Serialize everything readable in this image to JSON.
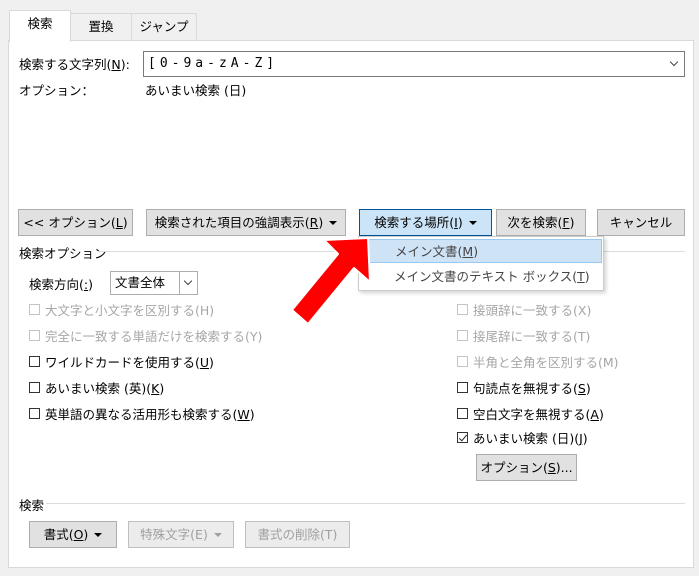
{
  "tabs": [
    "検索",
    "置換",
    "ジャンプ"
  ],
  "find": {
    "label": "検索する文字列",
    "label_key": "N",
    "label_suffix": "):",
    "value": "[0-9a-zA-Z]",
    "options_label": "オプション：",
    "options_value": "あいまい検索 (日)"
  },
  "buttons": {
    "less": "<< オプション(",
    "less_key": "L",
    "highlight": "検索された項目の強調表示(",
    "highlight_key": "R",
    "find_in": "検索する場所(",
    "find_in_key": "I",
    "find_next": "次を検索(",
    "find_next_key": "F",
    "cancel": "キャンセル"
  },
  "menu": {
    "items": [
      {
        "label": "メイン文書(",
        "key": "M"
      },
      {
        "label": "メイン文書のテキスト ボックス(",
        "key": "T"
      }
    ]
  },
  "search_options": {
    "title": "検索オプション",
    "direction_label": "検索方向(",
    "direction_key": ":",
    "direction_value": "文書全体",
    "left": [
      {
        "label": "大文字と小文字を区別する(H)",
        "checked": false,
        "disabled": true
      },
      {
        "label": "完全に一致する単語だけを検索する(Y)",
        "checked": false,
        "disabled": true
      },
      {
        "label": "ワイルドカードを使用する(",
        "key": "U",
        "checked": false,
        "disabled": false
      },
      {
        "label": "あいまい検索 (英)(",
        "key": "K",
        "checked": false,
        "disabled": false
      },
      {
        "label": "英単語の異なる活用形も検索する(",
        "key": "W",
        "checked": false,
        "disabled": false
      }
    ],
    "right": [
      {
        "label": "接頭辞に一致する(X)",
        "checked": false,
        "disabled": true
      },
      {
        "label": "接尾辞に一致する(T)",
        "checked": false,
        "disabled": true
      },
      {
        "label": "半角と全角を区別する(M)",
        "checked": false,
        "disabled": true
      },
      {
        "label": "句読点を無視する(",
        "key": "S",
        "checked": false,
        "disabled": false
      },
      {
        "label": "空白文字を無視する(",
        "key": "A",
        "checked": false,
        "disabled": false
      },
      {
        "label": "あいまい検索 (日)(",
        "key": "J",
        "checked": true,
        "disabled": false
      }
    ],
    "options_button": "オプション(",
    "options_button_key": "S",
    "options_button_suffix": ")..."
  },
  "search_section": {
    "title": "検索",
    "format": "書式(",
    "format_key": "O",
    "special": "特殊文字(E)",
    "no_format": "書式の削除(T)"
  },
  "colors": {
    "pressed_bg": "#cce4f7",
    "arrow": "#ff0000"
  }
}
